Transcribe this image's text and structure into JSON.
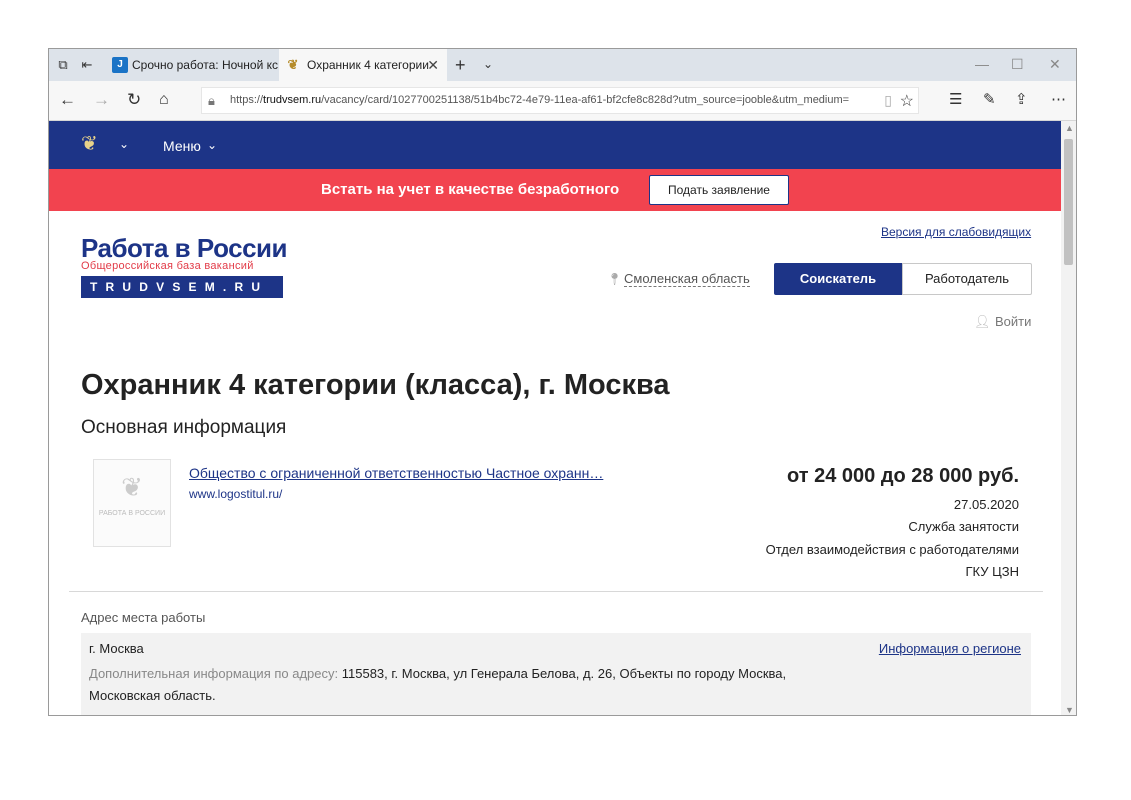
{
  "browser": {
    "tabs": [
      {
        "label": "Срочно работа: Ночной кс",
        "favicon": "J"
      },
      {
        "label": "Охранник 4 категории",
        "favicon": "emblem"
      }
    ],
    "url_prefix": "https://",
    "url_host": "trudvsem.ru",
    "url_path": "/vacancy/card/1027700251138/51b4bc72-4e79-11ea-af61-bf2cfe8c828d?utm_source=jooble&utm_medium="
  },
  "site": {
    "menu_label": "Меню",
    "banner_text": "Встать на учет в качестве безработного",
    "banner_button": "Подать заявление",
    "logo_title": "Работа в России",
    "logo_subtitle": "Общероссийская база вакансий",
    "logo_domain": "TRUDVSEM.RU",
    "a11y_link": "Версия для слабовидящих",
    "region": "Смоленская область",
    "role_seeker": "Соискатель",
    "role_employer": "Работодатель",
    "login": "Войти"
  },
  "vacancy": {
    "title": "Охранник 4 категории (класса), г. Москва",
    "section_title": "Основная информация",
    "company_logo_caption": "РАБОТА В РОССИИ",
    "company_name": "Общество с ограниченной ответственностью Частное охранн…",
    "company_site": "www.logostitul.ru/",
    "salary": "от 24 000 до 28 000 руб.",
    "date": "27.05.2020",
    "source_1": "Служба занятости",
    "source_2": "Отдел взаимодействия с работодателями",
    "source_3": "ГКУ ЦЗН",
    "address_label": "Адрес места работы",
    "address_city": "г. Москва",
    "address_more_label": "Дополнительная информация по адресу:",
    "address_more_value": "115583, г. Москва, ул Генерала Белова, д. 26, Объекты по городу Москва, Московская область.",
    "region_info_link": "Информация о регионе"
  },
  "colors": {
    "primary": "#1d3487",
    "banner": "#f2434f",
    "logo_red": "#e23b48"
  }
}
